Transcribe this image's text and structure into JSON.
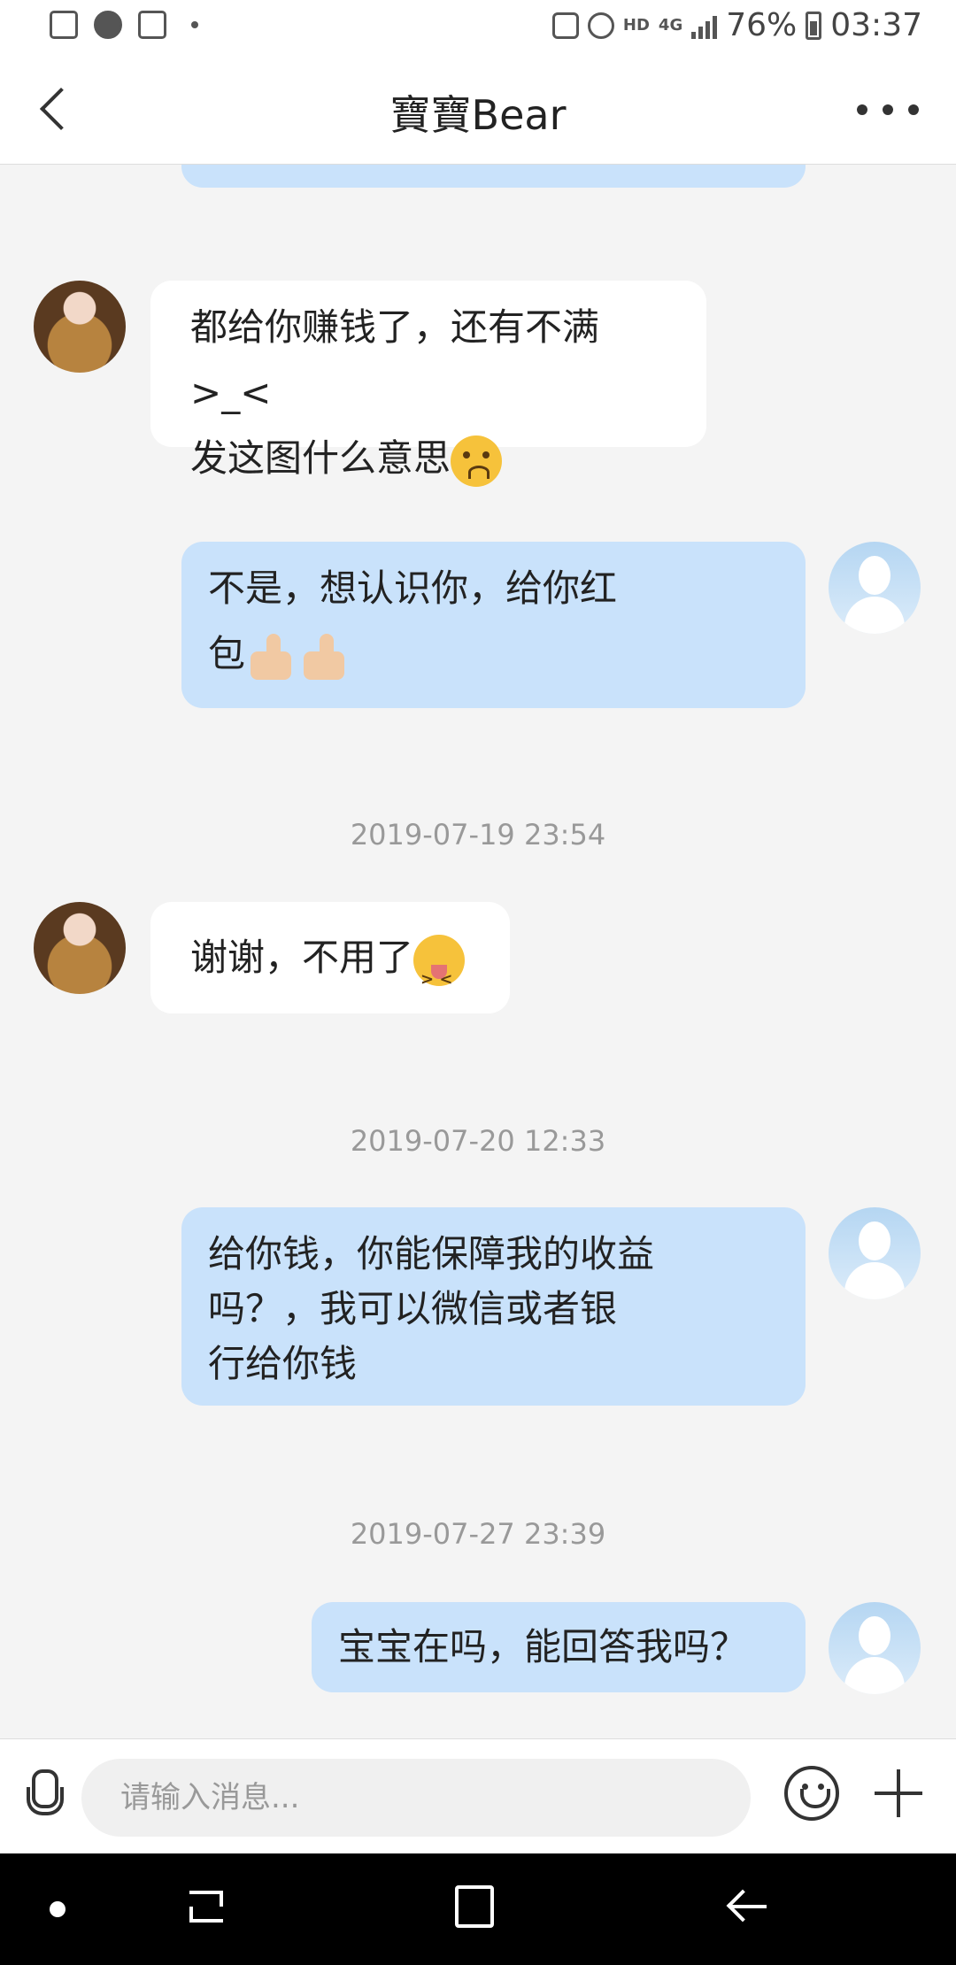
{
  "status_bar": {
    "battery": "76%",
    "time": "03:37",
    "network": "4G",
    "hd_badge": "HD"
  },
  "header": {
    "title": "寶寶Bear"
  },
  "messages": [
    {
      "side": "in",
      "line1": "都给你赚钱了，还有不满>_<",
      "line2": "发这图什么意思",
      "emoji": "worried-face"
    },
    {
      "side": "out",
      "line1": "不是，想认识你，给你红",
      "line2": "包",
      "emoji": "thumbs-up x2"
    },
    {
      "timestamp": "2019-07-19 23:54"
    },
    {
      "side": "in",
      "line1": "谢谢，不用了",
      "emoji": "squinting-tongue-face"
    },
    {
      "timestamp": "2019-07-20 12:33"
    },
    {
      "side": "out",
      "line1": "给你钱，你能保障我的收益",
      "line2": "吗？，我可以微信或者银",
      "line3": "行给你钱"
    },
    {
      "timestamp": "2019-07-27 23:39"
    },
    {
      "side": "out",
      "line1": "宝宝在吗，能回答我吗？"
    }
  ],
  "input": {
    "placeholder": "请输入消息..."
  },
  "colors": {
    "outgoing_bubble": "#c9e2fb",
    "incoming_bubble": "#ffffff",
    "background": "#f4f4f4"
  }
}
